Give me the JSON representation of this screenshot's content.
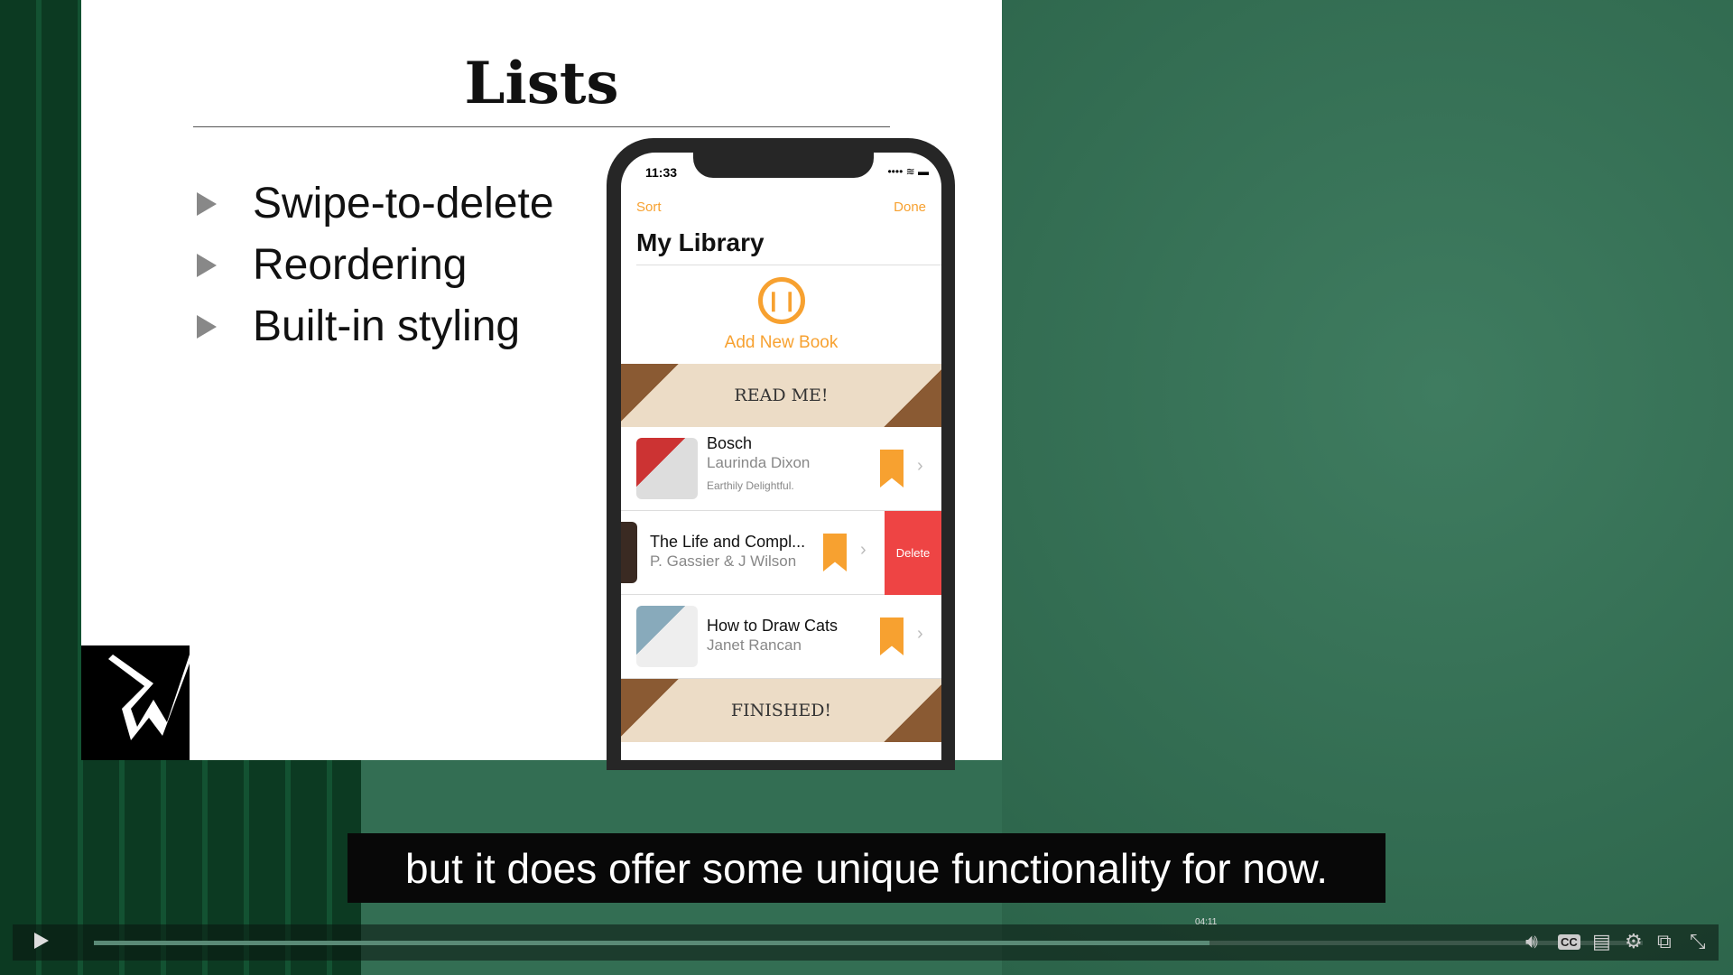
{
  "slide": {
    "title": "Lists",
    "bullets": [
      "Swipe-to-delete",
      "Reordering",
      "Built-in styling"
    ]
  },
  "phone": {
    "time": "11:33",
    "sort": "Sort",
    "done": "Done",
    "heading": "My Library",
    "add_book": "Add New Book",
    "sections": [
      "READ ME!",
      "FINISHED!"
    ],
    "books": [
      {
        "title": "Bosch",
        "author": "Laurinda Dixon",
        "review": "Earthily Delightful."
      },
      {
        "title": "The Life and Compl...",
        "author": "P. Gassier & J Wilson"
      },
      {
        "title": "How to Draw Cats",
        "author": "Janet Rancan"
      }
    ],
    "delete": "Delete",
    "accent": "#f7a130",
    "delete_color": "#ee4444"
  },
  "player": {
    "subtitle": "but it does offer some unique functionality for now.",
    "time_tooltip": "04:11",
    "progress_percent": 72
  }
}
